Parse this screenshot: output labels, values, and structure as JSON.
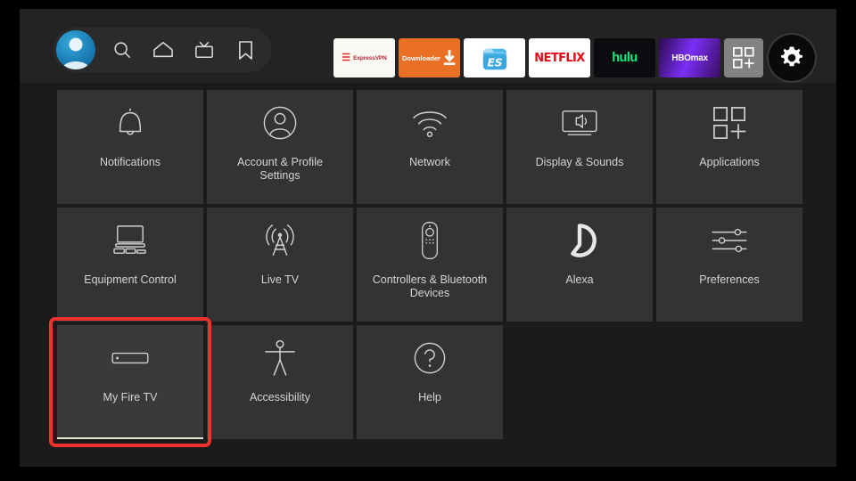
{
  "screen": {
    "background_color": "#1b1b1b",
    "letterbox_color": "#000000"
  },
  "topbar": {
    "background_color": "#232323",
    "nav": {
      "items": [
        {
          "name": "profile-avatar",
          "icon": "avatar-icon",
          "label": "Profile"
        },
        {
          "name": "search",
          "icon": "search-icon",
          "label": "Search"
        },
        {
          "name": "home",
          "icon": "home-icon",
          "label": "Home"
        },
        {
          "name": "live-tv",
          "icon": "tv-icon",
          "label": "Live"
        },
        {
          "name": "watchlist",
          "icon": "bookmark-icon",
          "label": "Watchlist"
        }
      ]
    },
    "apps": [
      {
        "name": "expressvpn",
        "label": "ExpressVPN",
        "mark": "≡",
        "bg": "#faf8f3"
      },
      {
        "name": "downloader",
        "label": "Downloader",
        "bg": "#ea7026"
      },
      {
        "name": "es-file-explorer",
        "label": "ES",
        "bg": "#ffffff"
      },
      {
        "name": "netflix",
        "label": "NETFLIX",
        "bg": "#ffffff"
      },
      {
        "name": "hulu",
        "label": "hulu",
        "bg": "#0b0c0f"
      },
      {
        "name": "hbomax",
        "label": "HBOmax",
        "bg": "#7b2ff7"
      }
    ],
    "apps_grid_button": {
      "label": "Apps",
      "icon": "apps-grid-plus-icon"
    },
    "settings_button": {
      "label": "Settings",
      "icon": "gear-icon",
      "focused": true
    }
  },
  "settings_grid": {
    "rows": [
      [
        {
          "label": "Notifications",
          "icon": "bell-icon",
          "focused": false
        },
        {
          "label": "Account & Profile Settings",
          "icon": "person-circle-icon",
          "focused": false
        },
        {
          "label": "Network",
          "icon": "wifi-icon",
          "focused": false
        },
        {
          "label": "Display & Sounds",
          "icon": "display-sound-icon",
          "focused": false
        },
        {
          "label": "Applications",
          "icon": "apps-grid-plus-icon",
          "focused": false
        }
      ],
      [
        {
          "label": "Equipment Control",
          "icon": "equipment-icon",
          "focused": false
        },
        {
          "label": "Live TV",
          "icon": "antenna-icon",
          "focused": false
        },
        {
          "label": "Controllers & Bluetooth Devices",
          "icon": "remote-icon",
          "focused": false
        },
        {
          "label": "Alexa",
          "icon": "alexa-ring-icon",
          "focused": false
        },
        {
          "label": "Preferences",
          "icon": "sliders-icon",
          "focused": false
        }
      ],
      [
        {
          "label": "My Fire TV",
          "icon": "firestick-icon",
          "focused": true
        },
        {
          "label": "Accessibility",
          "icon": "accessibility-icon",
          "focused": false
        },
        {
          "label": "Help",
          "icon": "question-circle-icon",
          "focused": false
        }
      ]
    ]
  },
  "annotation": {
    "highlight_color": "#f0322e",
    "target_label": "My Fire TV"
  }
}
